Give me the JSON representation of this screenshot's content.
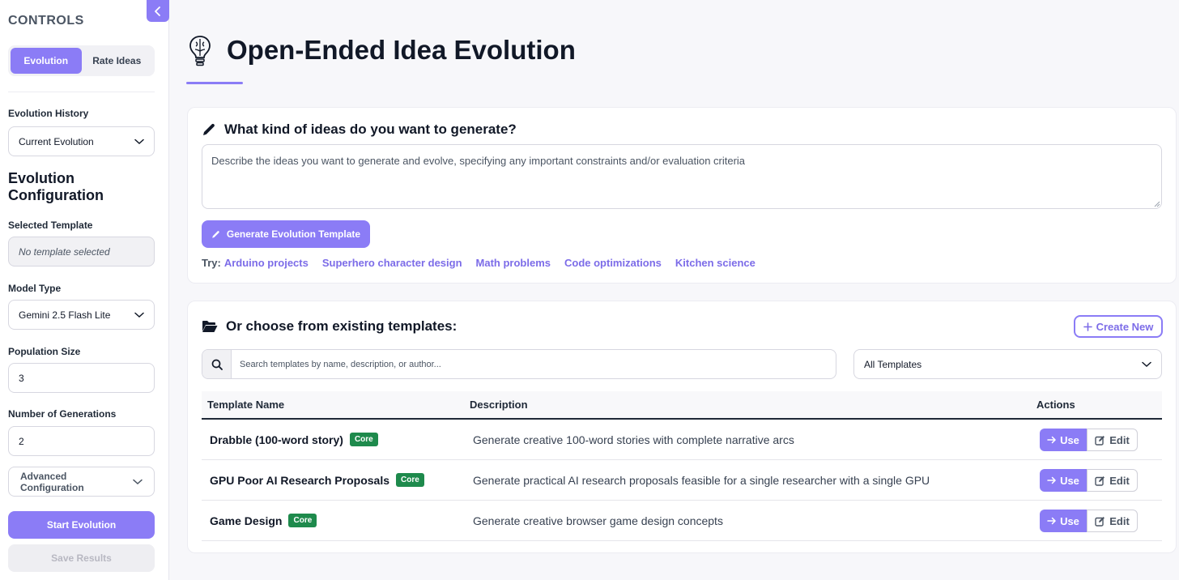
{
  "sidebar": {
    "title": "CONTROLS",
    "tabs": [
      {
        "label": "Evolution",
        "active": true
      },
      {
        "label": "Rate Ideas",
        "active": false
      }
    ],
    "evolution_history": {
      "label": "Evolution History",
      "value": "Current Evolution"
    },
    "config_title": "Evolution Configuration",
    "selected_template": {
      "label": "Selected Template",
      "value": "No template selected"
    },
    "model_type": {
      "label": "Model Type",
      "value": "Gemini 2.5 Flash Lite"
    },
    "population_size": {
      "label": "Population Size",
      "value": "3"
    },
    "generations": {
      "label": "Number of Generations",
      "value": "2"
    },
    "advanced_label": "Advanced Configuration",
    "start_label": "Start Evolution",
    "save_label": "Save Results"
  },
  "header": {
    "title": "Open-Ended Idea Evolution"
  },
  "generate": {
    "heading": "What kind of ideas do you want to generate?",
    "placeholder": "Describe the ideas you want to generate and evolve, specifying any important constraints and/or evaluation criteria",
    "button_label": "Generate Evolution Template",
    "try_label": "Try:",
    "suggestions": [
      "Arduino projects",
      "Superhero character design",
      "Math problems",
      "Code optimizations",
      "Kitchen science"
    ]
  },
  "templates": {
    "heading": "Or choose from existing templates:",
    "create_label": "Create New",
    "search_placeholder": "Search templates by name, description, or author...",
    "filter_value": "All Templates",
    "columns": {
      "name": "Template Name",
      "description": "Description",
      "actions": "Actions"
    },
    "use_label": "Use",
    "edit_label": "Edit",
    "rows": [
      {
        "name": "Drabble (100-word story)",
        "badge": "Core",
        "description": "Generate creative 100-word stories with complete narrative arcs"
      },
      {
        "name": "GPU Poor AI Research Proposals",
        "badge": "Core",
        "description": "Generate practical AI research proposals feasible for a single researcher with a single GPU"
      },
      {
        "name": "Game Design",
        "badge": "Core",
        "description": "Generate creative browser game design concepts"
      }
    ]
  },
  "colors": {
    "accent": "#8b7cf6",
    "badge": "#1e8a4c"
  }
}
